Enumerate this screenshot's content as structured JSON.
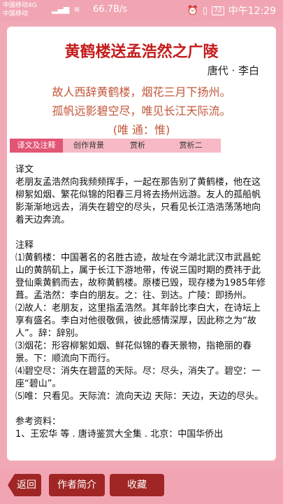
{
  "status_bar": {
    "carrier_1": "中国移动4G",
    "carrier_2": "中国移动",
    "speed": "66.7B/s",
    "battery": "72",
    "time": "中午12:29"
  },
  "poem": {
    "title": "黄鹤楼送孟浩然之广陵",
    "author": "唐代 · 李白",
    "lines": [
      "故人西辞黄鹤楼，烟花三月下扬州。",
      "孤帆远影碧空尽，唯见长江天际流。",
      "(唯 通：惟)"
    ]
  },
  "tabs": [
    {
      "label": "译文及注释",
      "active": true
    },
    {
      "label": "创作背景",
      "active": false
    },
    {
      "label": "赏析",
      "active": false
    },
    {
      "label": "赏析二",
      "active": false
    }
  ],
  "content": {
    "translation_heading": "译文",
    "translation": "老朋友孟浩然向我频频挥手，一起在那告别了黄鹤楼，他在这柳絮如烟、繁花似锦的阳春三月将去扬州远游。友人的孤船帆影渐渐地远去，消失在碧空的尽头，只看见长江浩浩荡荡地向着天边奔流。",
    "notes_heading": "注释",
    "notes": [
      "⑴黄鹤楼：中国著名的名胜古迹，故址在今湖北武汉市武昌蛇山的黄鹄矶上，属于长江下游地带，传说三国时期的费祎于此登仙乘黄鹤而去，故称黄鹤楼。原楼已毁，现存楼为1985年修葺。孟浩然：李白的朋友。之：往、到达。广陵：即扬州。",
      "⑵故人：老朋友，这里指孟浩然。其年龄比李白大，在诗坛上享有盛名。李白对他很敬佩，彼此感情深厚，因此称之为“故人”。辞：辞别。",
      "⑶烟花：形容柳絮如烟、鲜花似锦的春天景物，指艳丽的春景。下：顺流向下而行。",
      "⑷碧空尽：消失在碧蓝的天际。尽：尽头，消失了。碧空：一座“碧山”。",
      "⑸唯：只看见。天际流：流向天边 天际：天边，天边的尽头。"
    ],
    "reference_heading": "参考资料：",
    "reference_partial": "1、王宏华 等 . 唐诗鉴赏大全集 . 北京：中国华侨出"
  },
  "bottom_bar": {
    "back": "返回",
    "profile": "作者简介",
    "favorite": "收藏"
  }
}
